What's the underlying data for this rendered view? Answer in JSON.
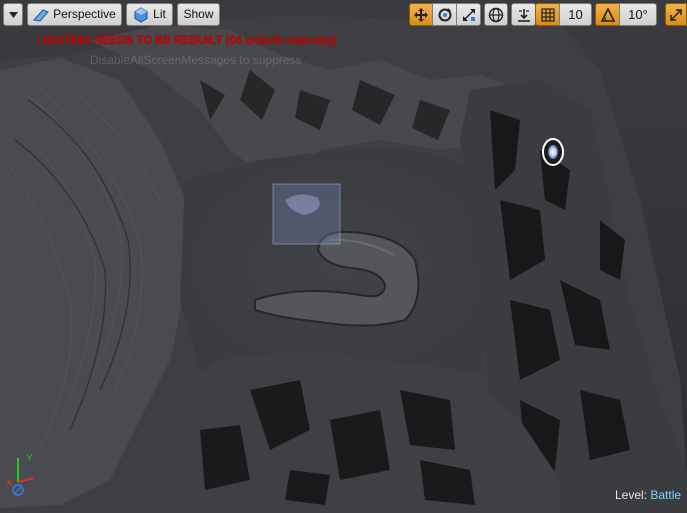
{
  "toolbar": {
    "view_mode_label": "Perspective",
    "lit_label": "Lit",
    "show_label": "Show",
    "grid_snap_value": "10",
    "rotation_snap_value": "10°"
  },
  "warnings": {
    "lighting": "LIGHTING NEEDS TO BE REBUILT (04 unbuilt object(s))",
    "ghost_text": "DisableAllScreenMessages to suppress"
  },
  "status": {
    "level_prefix": "Level:",
    "level_name": "Battle"
  },
  "gizmo": {
    "x_label": "X",
    "y_label": "Y"
  },
  "colors": {
    "accent_active": "#e8a030",
    "warning_red": "#d00000",
    "level_name": "#7fd3ff",
    "terrain": "#3c3d40",
    "selection_box": "#7f8fc8"
  },
  "icons": [
    "dropdown-arrow-icon",
    "perspective-icon",
    "lit-sphere-icon",
    "translate-icon",
    "rotate-icon",
    "scale-icon",
    "world-local-icon",
    "surface-snap-icon",
    "grid-icon",
    "rotation-snap-icon",
    "maximize-icon"
  ]
}
